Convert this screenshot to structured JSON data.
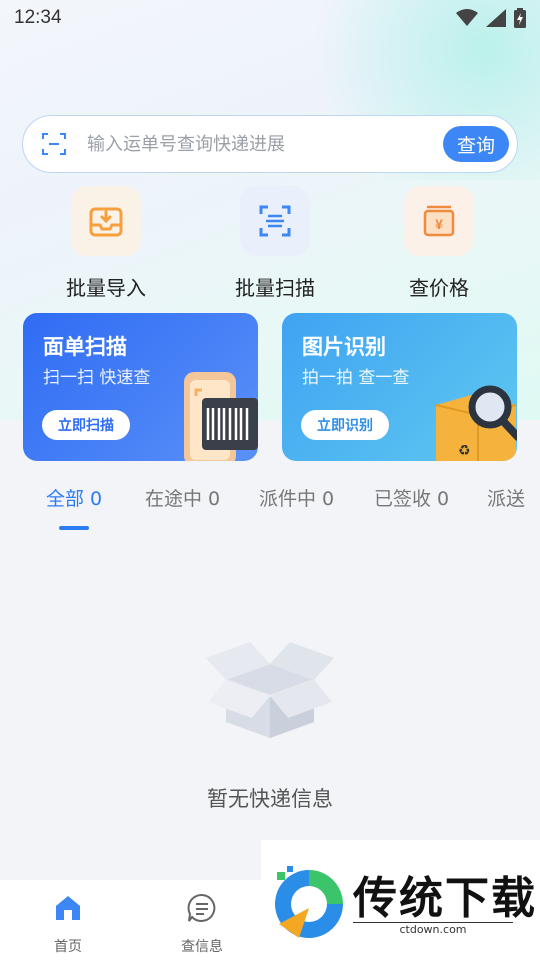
{
  "status_bar": {
    "time": "12:34"
  },
  "search": {
    "placeholder": "输入运单号查询快递进展",
    "button_label": "查询"
  },
  "quick_actions": [
    {
      "label": "批量导入",
      "icon": "inbox-import-icon"
    },
    {
      "label": "批量扫描",
      "icon": "scan-icon"
    },
    {
      "label": "查价格",
      "icon": "price-icon"
    }
  ],
  "promos": [
    {
      "title": "面单扫描",
      "subtitle": "扫一扫 快速查",
      "button": "立即扫描",
      "color": "#3a6ff5"
    },
    {
      "title": "图片识别",
      "subtitle": "拍一拍 查一查",
      "button": "立即识别",
      "color": "#44aef0"
    }
  ],
  "tabs": [
    {
      "label": "全部 0",
      "active": true
    },
    {
      "label": "在途中 0"
    },
    {
      "label": "派件中 0"
    },
    {
      "label": "已签收 0"
    },
    {
      "label": "派送"
    }
  ],
  "empty_state": {
    "text": "暂无快递信息"
  },
  "bottom_nav": [
    {
      "label": "首页",
      "icon": "home-icon",
      "active": true
    },
    {
      "label": "查信息",
      "icon": "message-icon"
    }
  ],
  "watermark": {
    "title": "传统下载",
    "url": "ctdown.com"
  },
  "colors": {
    "accent": "#2d7cf3",
    "orange": "#f5a03c"
  }
}
